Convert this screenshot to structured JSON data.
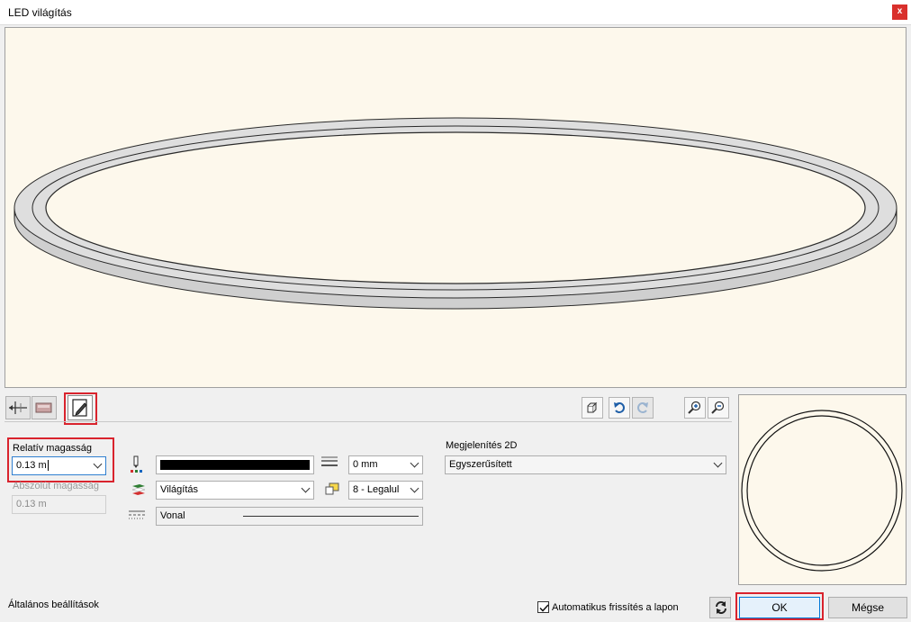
{
  "window": {
    "title": "LED világítás",
    "close_label": "x"
  },
  "tabs": [
    {
      "icon": "profile-dimension-icon"
    },
    {
      "icon": "material-icon"
    },
    {
      "icon": "pencil-drawing-icon",
      "active": true
    }
  ],
  "toolbar": {
    "icons": [
      "3d-box-icon",
      "undo-icon",
      "redo-icon",
      "zoom-in-icon",
      "zoom-out-icon"
    ]
  },
  "height": {
    "relative_label": "Relatív magasság",
    "relative_value": "0.13 m",
    "absolute_label": "Abszolút magasság",
    "absolute_value": "0.13 m"
  },
  "pen": {
    "line_thickness": "0 mm",
    "layer": "Világítás",
    "priority": "8 - Legalul",
    "line_type": "Vonal"
  },
  "display2d": {
    "label": "Megjelenítés 2D",
    "value": "Egyszerűsített"
  },
  "footer": {
    "general_settings": "Általános beállítások",
    "auto_refresh_label": "Automatikus frissítés a lapon",
    "auto_refresh_checked": true,
    "ok_label": "OK",
    "cancel_label": "Mégse"
  }
}
